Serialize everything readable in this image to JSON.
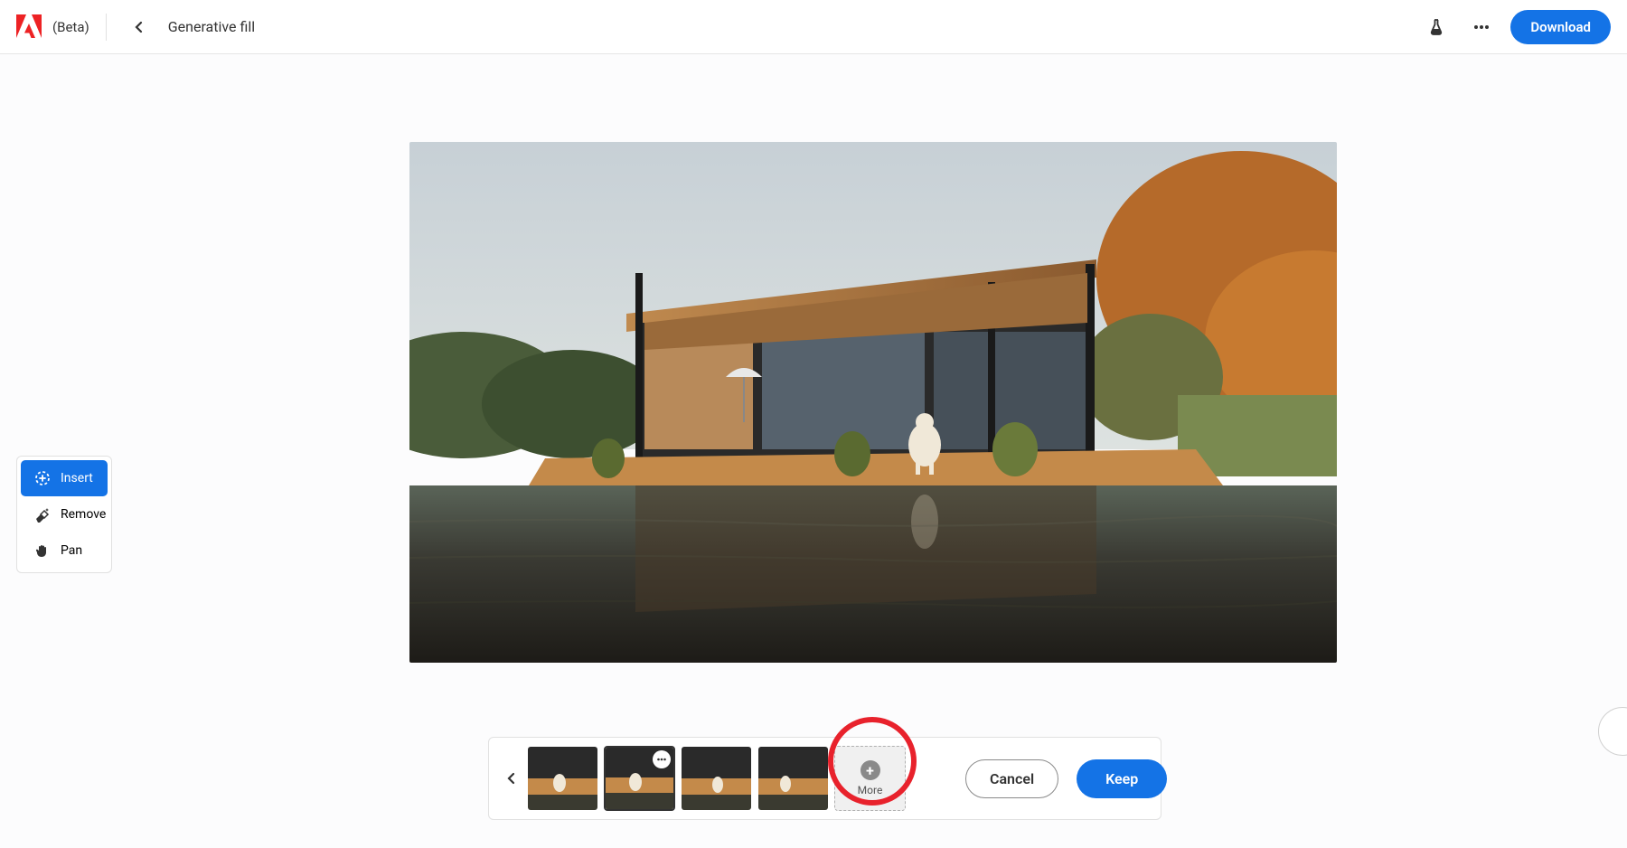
{
  "header": {
    "beta_label": "(Beta)",
    "breadcrumb_title": "Generative fill",
    "download_label": "Download"
  },
  "toolbar": {
    "items": [
      {
        "label": "Insert",
        "icon": "insert-dashed-circle-icon",
        "active": true
      },
      {
        "label": "Remove",
        "icon": "eraser-sparkle-icon",
        "active": false
      },
      {
        "label": "Pan",
        "icon": "hand-icon",
        "active": false
      }
    ]
  },
  "action_bar": {
    "thumbnails": [
      {
        "selected": false
      },
      {
        "selected": true,
        "has_menu": true
      },
      {
        "selected": false
      },
      {
        "selected": false
      }
    ],
    "more_label": "More",
    "cancel_label": "Cancel",
    "keep_label": "Keep"
  },
  "highlight": {
    "target": "more-button"
  }
}
